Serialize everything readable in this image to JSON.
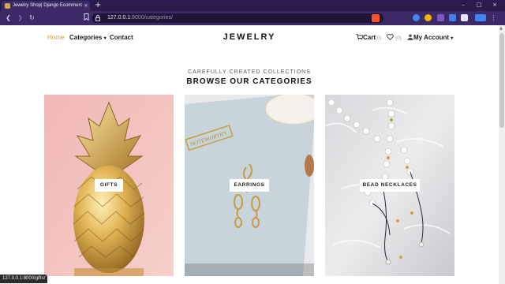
{
  "browser": {
    "tab_title": "Jewelry Shop| Django Ecommerce",
    "tab_close": "×",
    "new_tab": "+",
    "url_host": "127.0.0.1",
    "url_rest": ":8000/categories/",
    "status_url": "127.0.0.1:8000/gifts/",
    "window_controls": [
      "–",
      "□",
      "×"
    ],
    "extension_colors": [
      "#4285f4",
      "#f4b400",
      "#7e57c2",
      "#3b82f6",
      "#e8e4f5"
    ]
  },
  "header": {
    "nav": {
      "home": "Home",
      "categories": "Categories",
      "contact": "Contact"
    },
    "logo": "JEWELRY",
    "cart_label": "Cart",
    "cart_count": "(0)",
    "wishlist_count": "(0)",
    "account_label": "My Account"
  },
  "section": {
    "subtitle": "CAREFULLY CREATED COLLECTIONS",
    "title": "BROWSE OUR CATEGORIES"
  },
  "categories": [
    {
      "label": "GIFTS"
    },
    {
      "label": "EARRINGS"
    },
    {
      "label": "BEAD NECKLACES"
    }
  ],
  "colors": {
    "accent": "#d49a3a",
    "browser_chrome": "#2a1b4c",
    "toolbar": "#3b2a66"
  }
}
